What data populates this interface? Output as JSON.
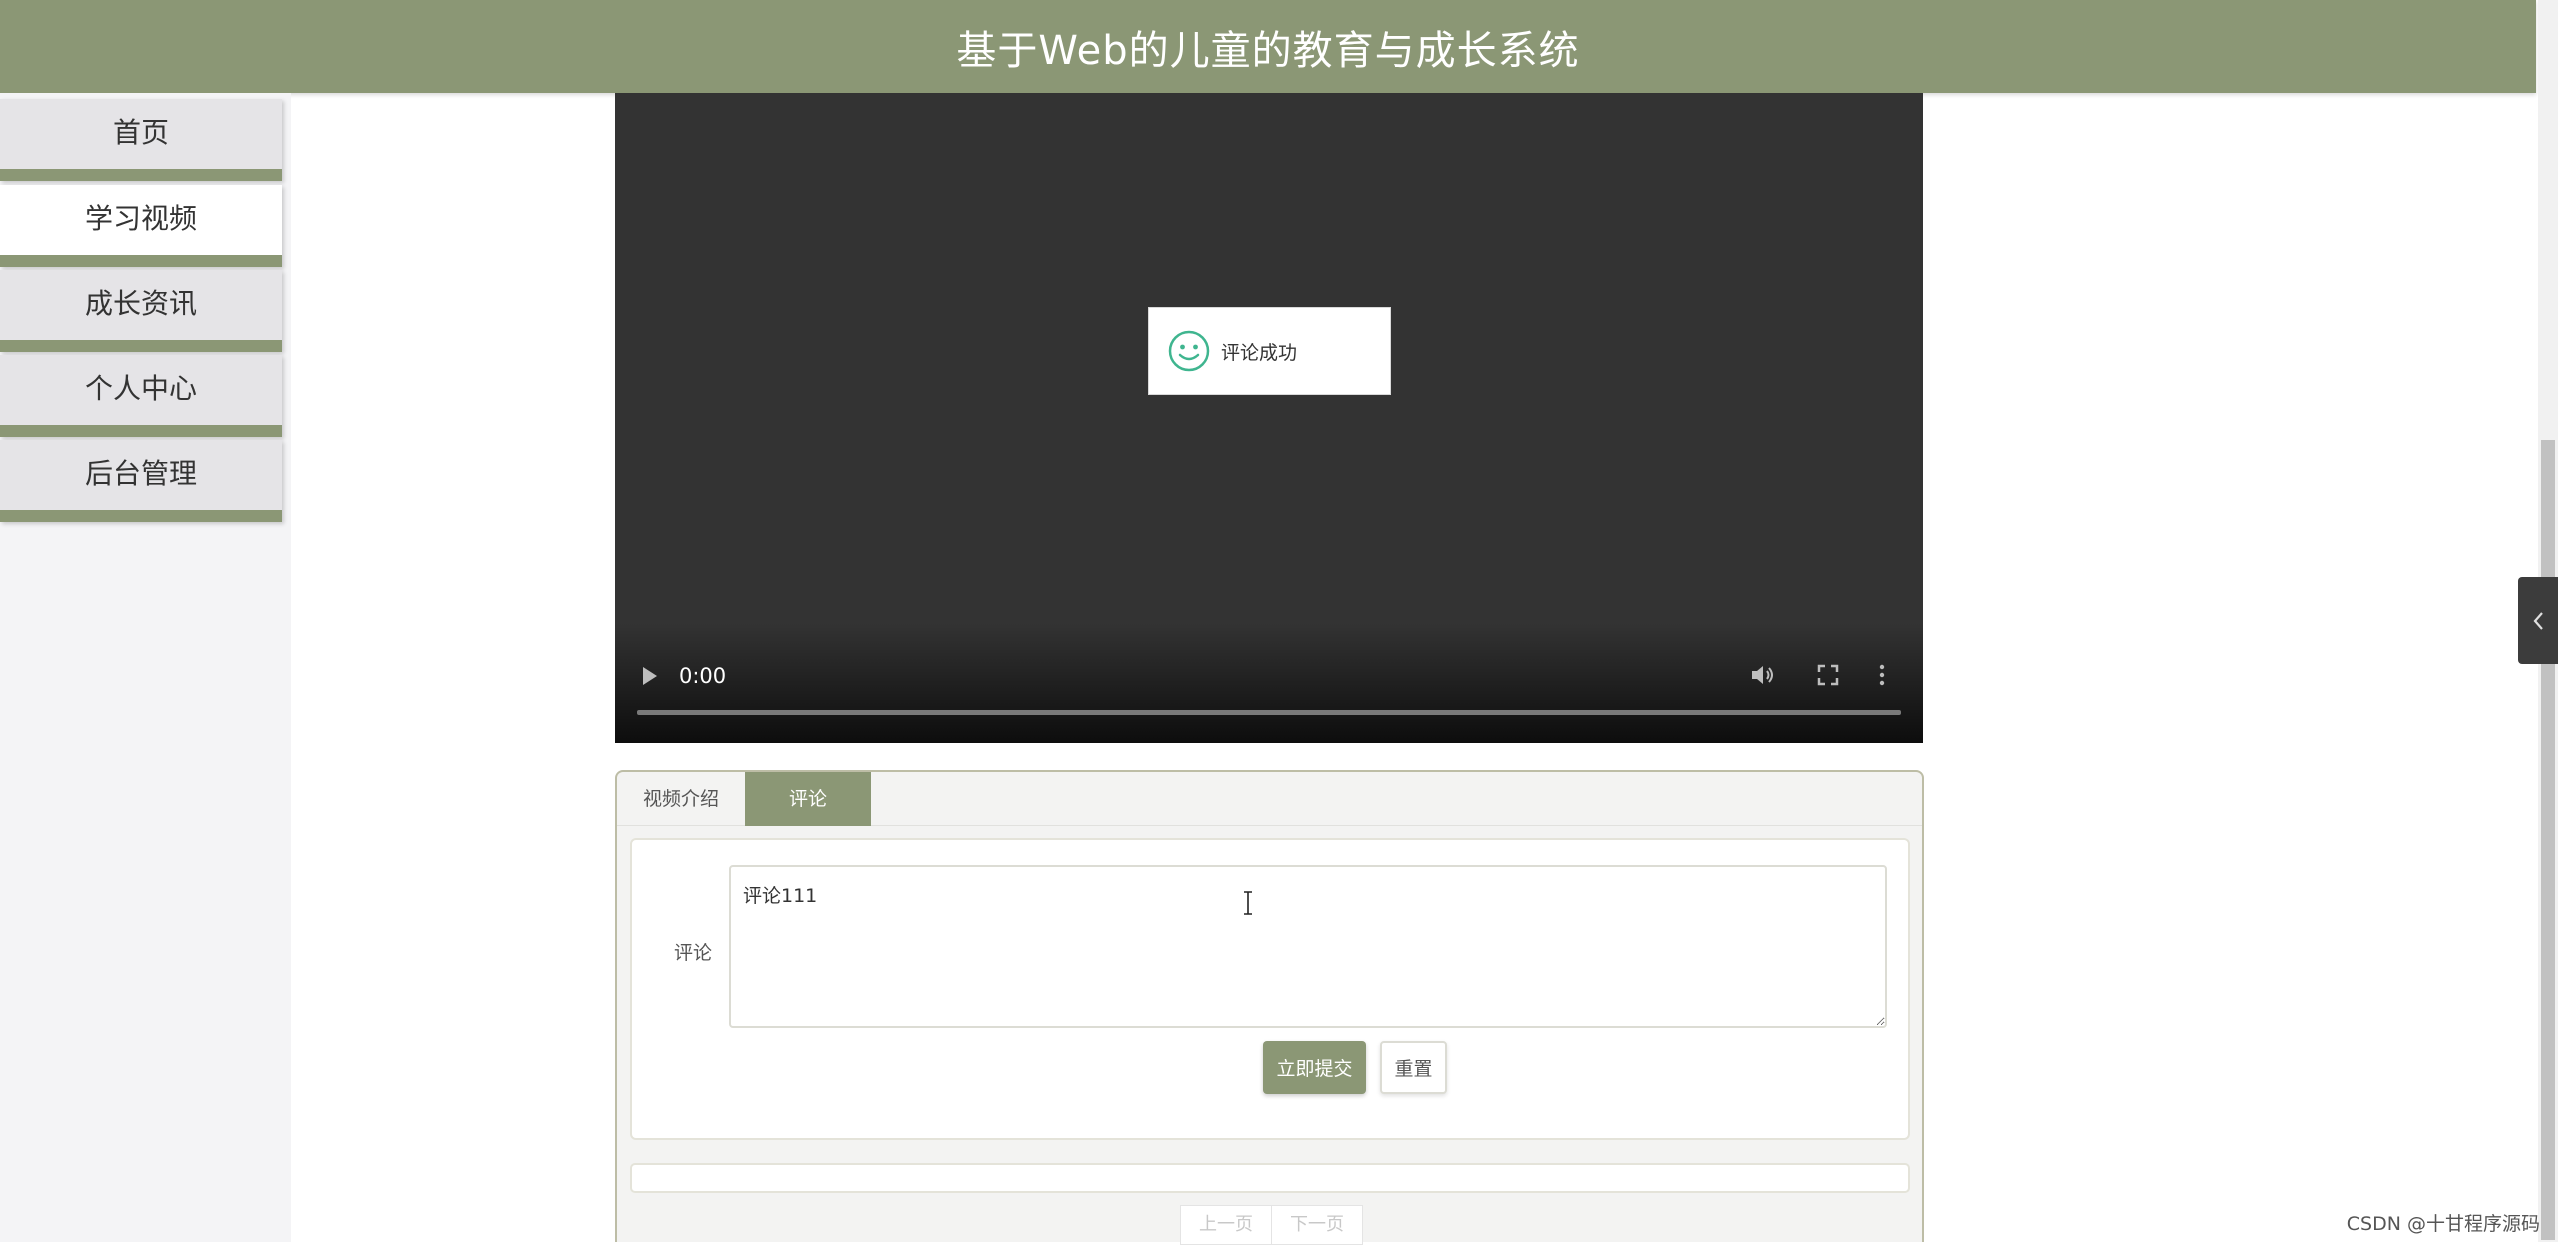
{
  "header": {
    "title": "基于Web的儿童的教育与成长系统"
  },
  "sidebar": {
    "items": [
      {
        "label": "首页",
        "active": false
      },
      {
        "label": "学习视频",
        "active": true
      },
      {
        "label": "成长资讯",
        "active": false
      },
      {
        "label": "个人中心",
        "active": false
      },
      {
        "label": "后台管理",
        "active": false
      }
    ]
  },
  "video": {
    "current_time": "0:00",
    "progress": 0,
    "icons": [
      "play-icon",
      "volume-icon",
      "fullscreen-icon",
      "more-icon"
    ]
  },
  "toast": {
    "message": "评论成功",
    "icon": "smile-icon"
  },
  "tabs": [
    {
      "label": "视频介绍",
      "active": false
    },
    {
      "label": "评论",
      "active": true
    }
  ],
  "comment_form": {
    "label": "评论",
    "value": "评论111",
    "submit_label": "立即提交",
    "reset_label": "重置"
  },
  "pagination": {
    "prev_label": "上一页",
    "next_label": "下一页"
  },
  "watermark": "CSDN @十甘程序源码",
  "colors": {
    "accent": "#8b9775",
    "video_bg": "#333333",
    "toast_icon": "#3fb58f"
  }
}
